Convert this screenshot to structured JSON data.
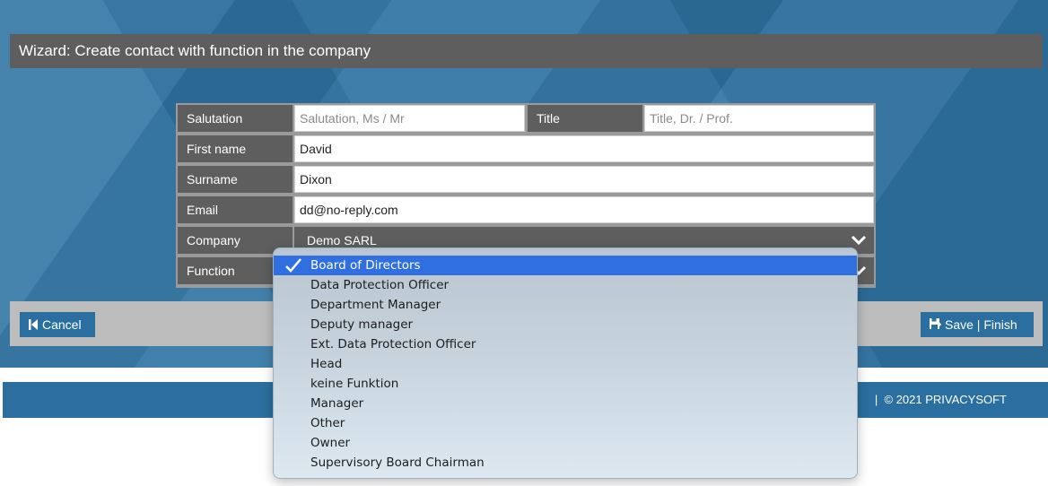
{
  "wizard": {
    "title": "Wizard: Create contact with function in the company"
  },
  "form": {
    "salutation": {
      "label": "Salutation",
      "value": "",
      "placeholder": "Salutation, Ms / Mr"
    },
    "title": {
      "label": "Title",
      "value": "",
      "placeholder": "Title, Dr. / Prof."
    },
    "first_name": {
      "label": "First name",
      "value": "David"
    },
    "surname": {
      "label": "Surname",
      "value": "Dixon"
    },
    "email": {
      "label": "Email",
      "value": "dd@no-reply.com"
    },
    "company": {
      "label": "Company",
      "value": "Demo SARL"
    },
    "function": {
      "label": "Function",
      "value": "Board of Directors"
    }
  },
  "actions": {
    "cancel_label": "Cancel",
    "save_label": "Save | Finish"
  },
  "footer": {
    "separator": "|",
    "copyright": "© 2021 PRIVACYSOFT"
  },
  "function_dropdown": {
    "selected": "Board of Directors",
    "options": [
      "Board of Directors",
      "Data Protection Officer",
      "Department Manager",
      "Deputy manager",
      "Ext. Data Protection Officer",
      "Head",
      "keine Funktion",
      "Manager",
      "Other",
      "Owner",
      "Supervisory Board Chairman"
    ]
  },
  "colors": {
    "background_blue": "#2f74a3",
    "header_gray": "#5e5e5e",
    "button_blue": "#2a6f9f",
    "selected_option": "#2f6fe0"
  },
  "icons": {
    "cancel": "skip-back-icon",
    "save": "save-icon",
    "dropdown": "chevron-down-icon",
    "selected": "checkmark-icon"
  }
}
